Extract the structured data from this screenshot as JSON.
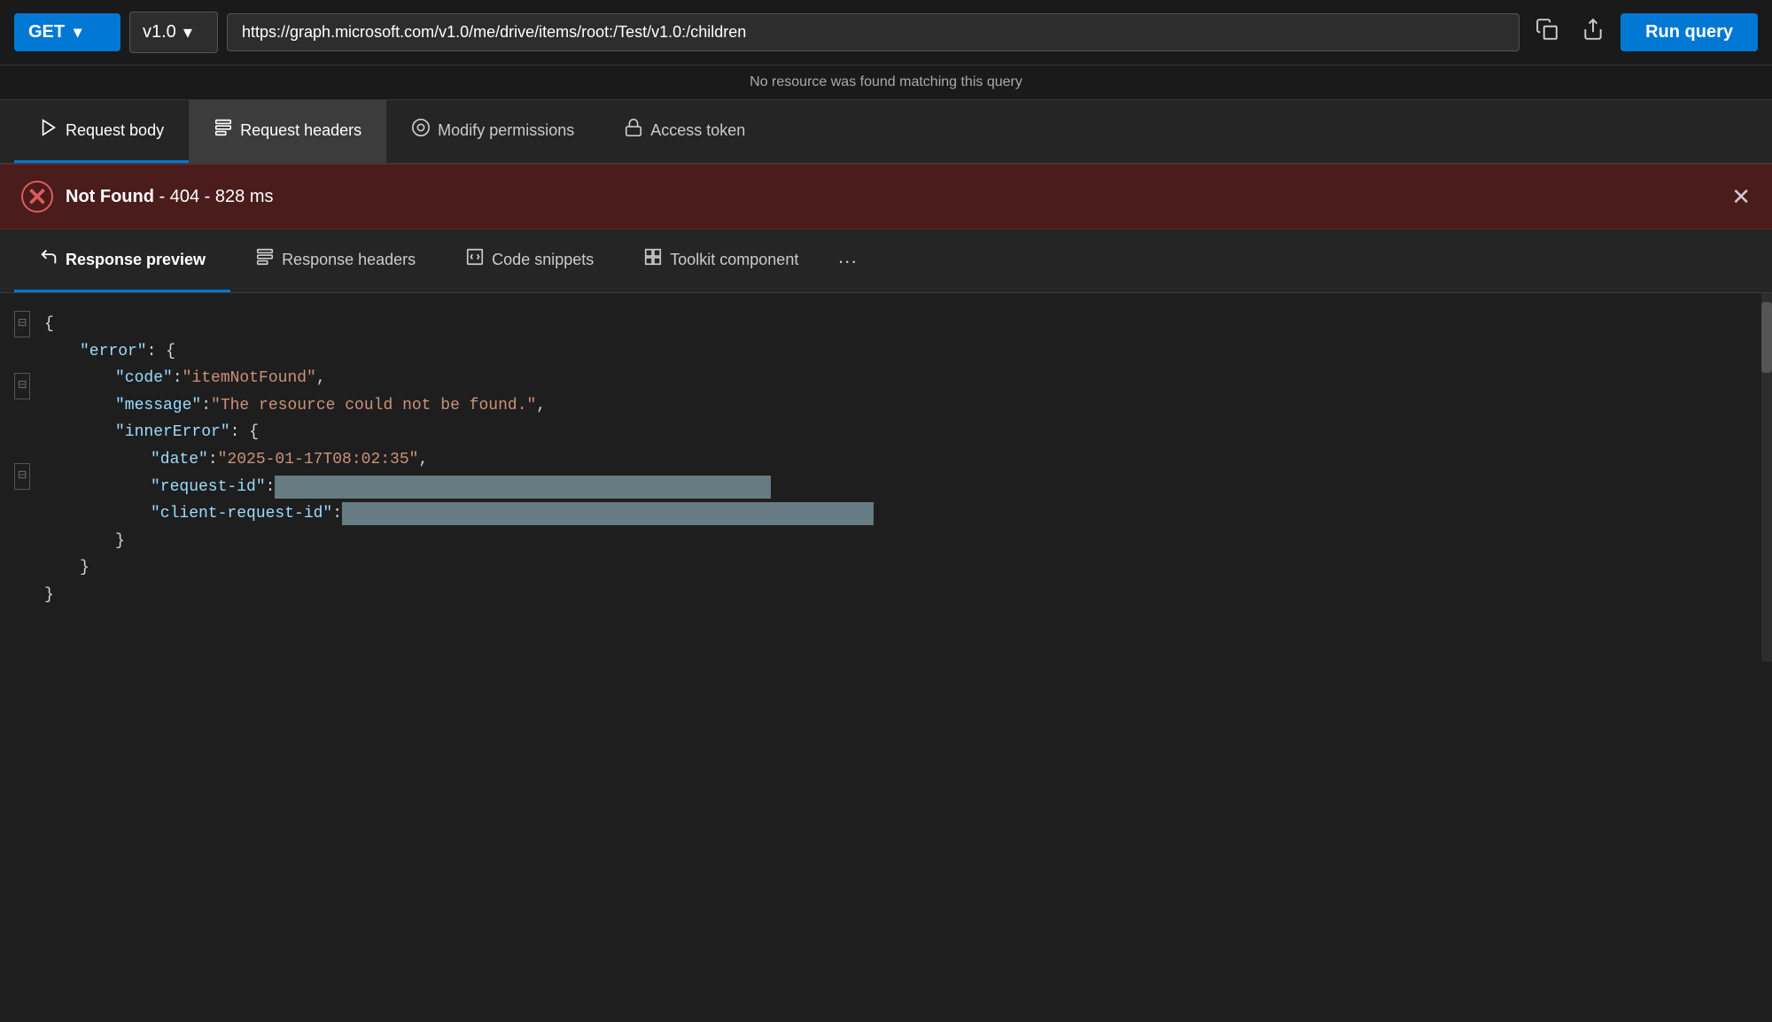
{
  "topbar": {
    "method": "GET",
    "method_chevron": "▾",
    "version": "v1.0",
    "version_chevron": "▾",
    "url": "https://graph.microsoft.com/v1.0/me/drive/items/root:/Test/v1.0:/children",
    "run_label": "Run query",
    "no_resource_msg": "No resource was found matching this query"
  },
  "request_tabs": [
    {
      "id": "request-body",
      "label": "Request body",
      "icon": "▷",
      "active": true,
      "selected": false
    },
    {
      "id": "request-headers",
      "label": "Request headers",
      "icon": "☰",
      "active": false,
      "selected": true
    },
    {
      "id": "modify-permissions",
      "label": "Modify permissions",
      "icon": "◎",
      "active": false,
      "selected": false
    },
    {
      "id": "access-token",
      "label": "Access token",
      "icon": "🔒",
      "active": false,
      "selected": false
    }
  ],
  "error_banner": {
    "status": "Not Found",
    "code": "404",
    "time": "828 ms",
    "full_text": "Not Found - 404 - 828 ms"
  },
  "response_tabs": [
    {
      "id": "response-preview",
      "label": "Response preview",
      "icon": "↩",
      "active": true
    },
    {
      "id": "response-headers",
      "label": "Response headers",
      "icon": "☰",
      "active": false
    },
    {
      "id": "code-snippets",
      "label": "Code snippets",
      "icon": "📋",
      "active": false
    },
    {
      "id": "toolkit-component",
      "label": "Toolkit component",
      "icon": "⊞",
      "active": false
    }
  ],
  "json_response": {
    "line1": "{",
    "line2_key": "\"error\"",
    "line2_punc": ": {",
    "line3_key": "\"code\"",
    "line3_val": "\"itemNotFound\"",
    "line4_key": "\"message\"",
    "line4_val": "\"The resource could not be found.\"",
    "line5_key": "\"innerError\"",
    "line5_punc": ": {",
    "line6_key": "\"date\"",
    "line6_val": "\"2025-01-17T08:02:35\"",
    "line7_key": "\"request-id\"",
    "line7_colon": ": ",
    "line8_key": "\"client-request-id\"",
    "line8_colon": ": ",
    "line9_close": "}",
    "line10_close": "}",
    "line11_close": "}"
  },
  "colors": {
    "accent": "#0078d4",
    "error_bg": "#4a1c1c",
    "error_border": "#6b2020",
    "tab_selected_bg": "#3c3c3c"
  }
}
